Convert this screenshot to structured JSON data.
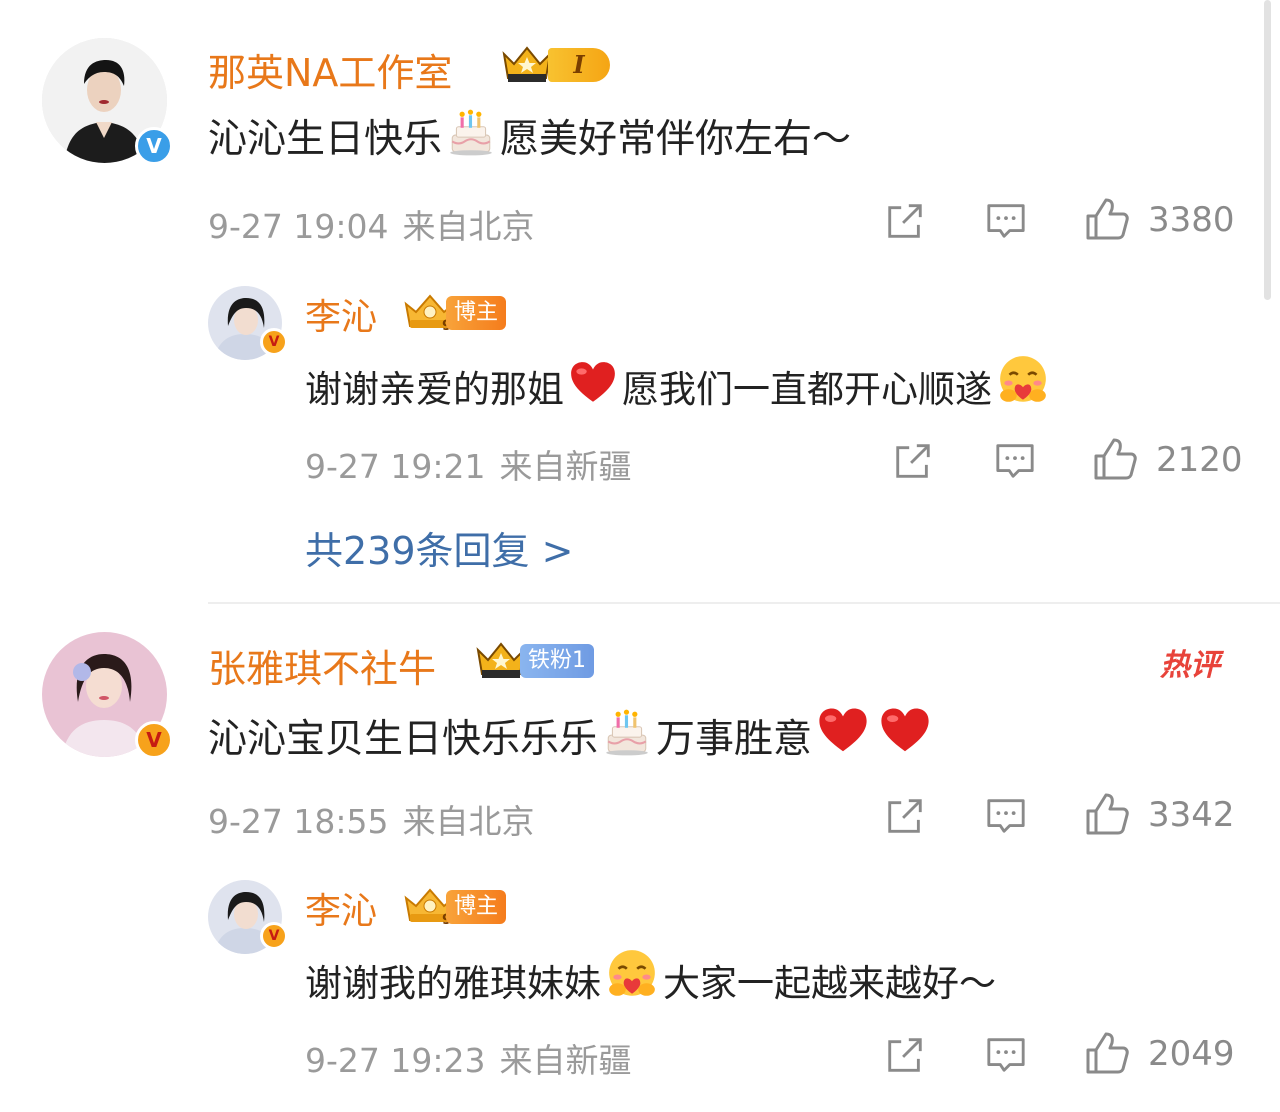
{
  "colors": {
    "name": "#e8781a",
    "link": "#3f6ea8",
    "meta": "#9a9a9a",
    "hot": "#e8433a",
    "heart": "#e02020"
  },
  "comments": [
    {
      "author": "那英NA工作室",
      "level": "I",
      "verified": "blue-v-icon",
      "text_parts": [
        "沁沁生日快乐",
        "愿美好常伴你左右～"
      ],
      "date": "9-27 19:04",
      "location": "来自北京",
      "likes": "3380",
      "reply": {
        "author": "李沁",
        "badge": "博主",
        "verified": "orange-v-icon",
        "text_parts": [
          "谢谢亲爱的那姐",
          "愿我们一直都开心顺遂"
        ],
        "date": "9-27 19:21",
        "location": "来自新疆",
        "likes": "2120"
      },
      "more_replies": "共239条回复 >"
    },
    {
      "author": "张雅琪不社牛",
      "badge": "铁粉1",
      "hot_tag": "热评",
      "verified": "orange-v-icon",
      "text_parts": [
        "沁沁宝贝生日快乐乐乐",
        "万事胜意"
      ],
      "date": "9-27 18:55",
      "location": "来自北京",
      "likes": "3342",
      "reply": {
        "author": "李沁",
        "badge": "博主",
        "verified": "orange-v-icon",
        "text_parts": [
          "谢谢我的雅琪妹妹",
          "大家一起越来越好～"
        ],
        "date": "9-27 19:23",
        "location": "来自新疆",
        "likes": "2049"
      }
    }
  ],
  "verify_glyph": "V"
}
